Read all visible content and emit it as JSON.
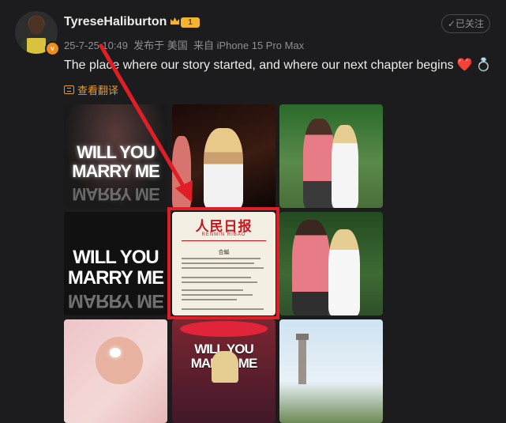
{
  "post": {
    "username": "TyreseHaliburton",
    "level": "1",
    "verified_mark": "v",
    "follow_label": "✓已关注",
    "meta_text": "25-7-25 10:49  发布于 美国  来自 iPhone 15 Pro Max",
    "caption": "The place where our story started, and where our next chapter begins",
    "caption_emoji": [
      "❤️",
      "💍"
    ],
    "translate_label": "查看翻译"
  },
  "tiles": {
    "will_you": "WILL YOU",
    "marry_me": "MARRY ME",
    "newspaper_head": "人民日报",
    "newspaper_sub": "RENMIN RIBAO",
    "newspaper_title": "合編"
  },
  "colors": {
    "accent_orange": "#e69a28",
    "annotation_red": "#e01e26",
    "background": "#1c1c1e"
  },
  "icons": [
    "crown-icon",
    "translate-icon",
    "heart-emoji",
    "ring-emoji",
    "red-arrow-annotation"
  ]
}
